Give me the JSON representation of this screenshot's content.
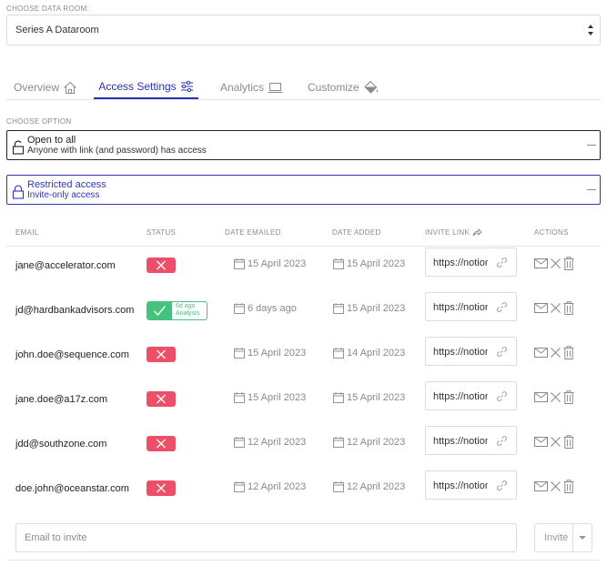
{
  "data_room": {
    "label": "CHOOSE DATA ROOM:",
    "selected": "Series A Dataroom"
  },
  "tabs": [
    {
      "label": "Overview",
      "icon": "home-icon",
      "active": false
    },
    {
      "label": "Access Settings",
      "icon": "sliders-icon",
      "active": true
    },
    {
      "label": "Analytics",
      "icon": "laptop-icon",
      "active": false
    },
    {
      "label": "Customize",
      "icon": "paint-bucket-icon",
      "active": false
    }
  ],
  "options": {
    "label": "CHOOSE OPTION",
    "open": {
      "title": "Open to all",
      "subtitle": "Anyone with link (and password) has access",
      "icon": "unlock-icon"
    },
    "restricted": {
      "title": "Restricted access",
      "subtitle": "Invite-only access",
      "icon": "lock-icon"
    }
  },
  "table": {
    "headers": {
      "email": "EMAIL",
      "status": "STATUS",
      "date_emailed": "DATE EMAILED",
      "date_added": "DATE ADDED",
      "invite_link": "INVITE LINK",
      "actions": "ACTIONS"
    },
    "rows": [
      {
        "email": "jane@accelerator.com",
        "status": "x",
        "date_emailed": "15 April 2023",
        "date_added": "15 April 2023",
        "link": "https://notion.so"
      },
      {
        "email": "jd@hardbankadvisors.com",
        "status": "ok",
        "status_line1": "6d ago",
        "status_line2": "Analysis",
        "date_emailed": "6 days ago",
        "date_added": "15 April 2023",
        "link": "https://notion.so"
      },
      {
        "email": "john.doe@sequence.com",
        "status": "x",
        "date_emailed": "15 April 2023",
        "date_added": "14 April 2023",
        "link": "https://notion.so"
      },
      {
        "email": "jane.doe@a17z.com",
        "status": "x",
        "date_emailed": "15 April 2023",
        "date_added": "15 April 2023",
        "link": "https://notion.so"
      },
      {
        "email": "jdd@southzone.com",
        "status": "x",
        "date_emailed": "12 April 2023",
        "date_added": "12 April 2023",
        "link": "https://notion.so"
      },
      {
        "email": "doe.john@oceanstar.com",
        "status": "x",
        "date_emailed": "12 April 2023",
        "date_added": "12 April 2023",
        "link": "https://notion.so"
      }
    ]
  },
  "invite": {
    "placeholder": "Email to invite",
    "button": "Invite"
  },
  "colors": {
    "accent": "#2930b8",
    "status_x": "#ec5069",
    "status_ok": "#46c27f"
  }
}
